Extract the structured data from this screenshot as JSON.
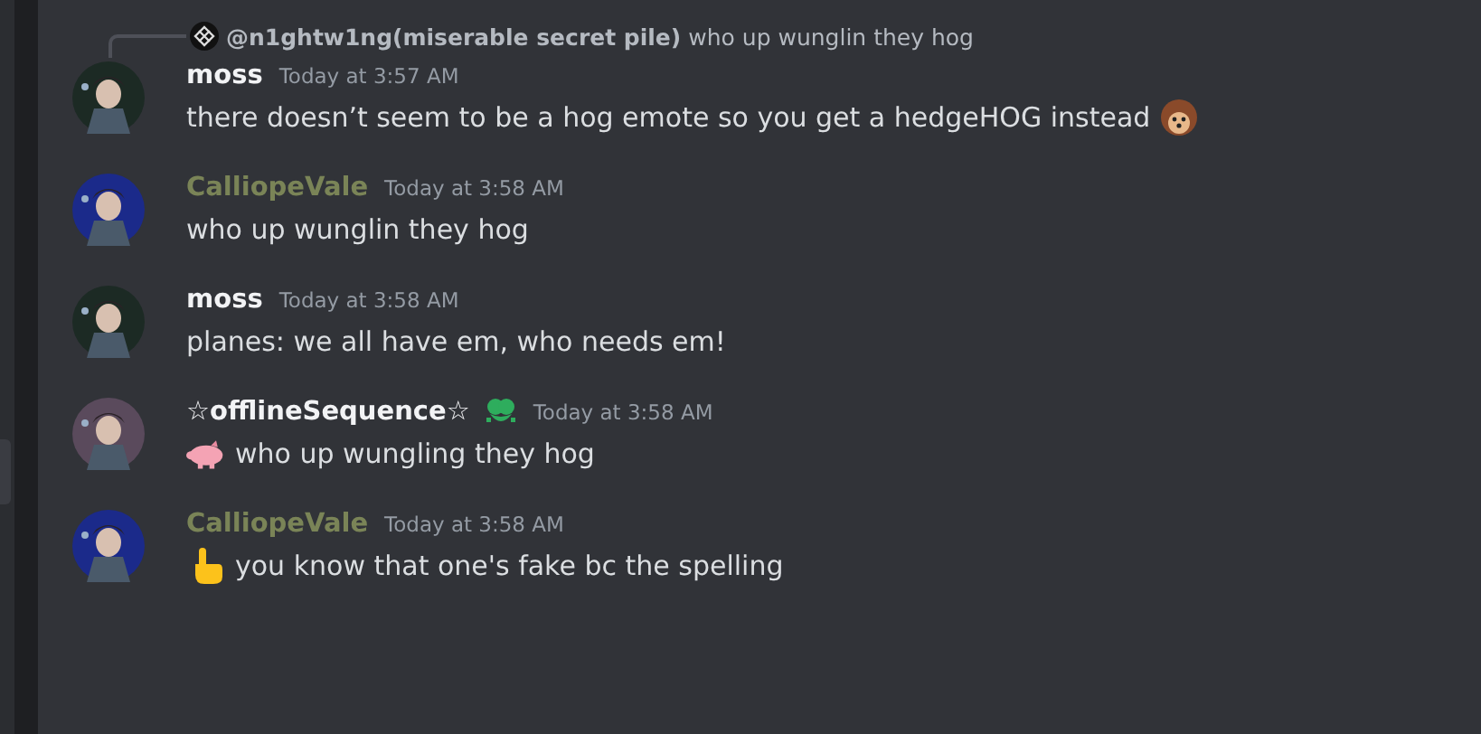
{
  "messages": [
    {
      "kind": "hedgehog-trail",
      "reply": {
        "author": "@n1ghtw1ng(miserable secret pile)",
        "text": "who up wunglin they hog"
      },
      "author": "moss",
      "color": "#f2f3f5",
      "badge": false,
      "time": "Today at 3:57 AM",
      "text": "there doesn’t seem to be a hog emote so you get a hedgeHOG instead"
    },
    {
      "kind": "plain",
      "author": "CalliopeVale",
      "color": "#7a8457",
      "badge": false,
      "time": "Today at 3:58 AM",
      "text": "who up wunglin they hog"
    },
    {
      "kind": "plain",
      "author": "moss",
      "color": "#f2f3f5",
      "badge": false,
      "time": "Today at 3:58 AM",
      "text": "planes: we all have em, who needs em!"
    },
    {
      "kind": "pig-lead",
      "author": "☆offlineSequence☆",
      "color": "#f2f3f5",
      "badge": true,
      "time": "Today at 3:58 AM",
      "text": "who up wungling they hog"
    },
    {
      "kind": "hand-lead",
      "author": "CalliopeVale",
      "color": "#7a8457",
      "badge": false,
      "time": "Today at 3:58 AM",
      "text": "you know that one's fake bc the spelling"
    }
  ]
}
